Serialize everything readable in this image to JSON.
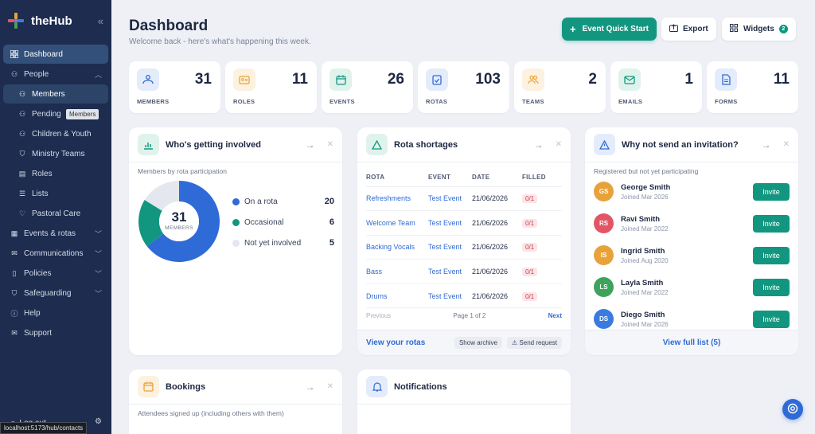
{
  "sidebar": {
    "brand": "theHub",
    "items": [
      {
        "label": "Dashboard"
      },
      {
        "label": "People"
      },
      {
        "label": "Members"
      },
      {
        "label": "Pending"
      },
      {
        "label": "Children & Youth"
      },
      {
        "label": "Ministry Teams"
      },
      {
        "label": "Roles"
      },
      {
        "label": "Lists"
      },
      {
        "label": "Pastoral Care"
      },
      {
        "label": "Events & rotas"
      },
      {
        "label": "Communications"
      },
      {
        "label": "Policies"
      },
      {
        "label": "Safeguarding"
      },
      {
        "label": "Help"
      },
      {
        "label": "Support"
      }
    ],
    "tooltip": "Members",
    "logout": "Log out"
  },
  "status_url": "localhost:5173/hub/contacts",
  "header": {
    "title": "Dashboard",
    "subtitle": "Welcome back - here's what's happening this week.",
    "quick_start": "Event Quick Start",
    "export": "Export",
    "widgets": "Widgets",
    "widgets_count": "2"
  },
  "stats": [
    {
      "label": "MEMBERS",
      "value": "31",
      "icon": "members-icon"
    },
    {
      "label": "ROLES",
      "value": "11",
      "icon": "id-badge-icon"
    },
    {
      "label": "EVENTS",
      "value": "26",
      "icon": "calendar-icon"
    },
    {
      "label": "ROTAS",
      "value": "103",
      "icon": "clipboard-check-icon"
    },
    {
      "label": "TEAMS",
      "value": "2",
      "icon": "team-icon"
    },
    {
      "label": "EMAILS",
      "value": "1",
      "icon": "envelope-icon"
    },
    {
      "label": "FORMS",
      "value": "11",
      "icon": "document-icon"
    }
  ],
  "involved": {
    "title": "Who's getting involved",
    "subtitle": "Members by rota participation",
    "total": "31",
    "total_label": "MEMBERS",
    "legend": [
      {
        "label": "On a rota",
        "value": "20",
        "color": "#2f6bd6"
      },
      {
        "label": "Occasional",
        "value": "6",
        "color": "#13967f"
      },
      {
        "label": "Not yet involved",
        "value": "5",
        "color": "#e4e7ee"
      }
    ]
  },
  "rota": {
    "title": "Rota shortages",
    "columns": [
      "ROTA",
      "EVENT",
      "DATE",
      "FILLED"
    ],
    "rows": [
      [
        "Refreshments",
        "Test Event",
        "21/06/2026",
        "0/1"
      ],
      [
        "Welcome Team",
        "Test Event",
        "21/06/2026",
        "0/1"
      ],
      [
        "Backing Vocals",
        "Test Event",
        "21/06/2026",
        "0/1"
      ],
      [
        "Bass",
        "Test Event",
        "21/06/2026",
        "0/1"
      ],
      [
        "Drums",
        "Test Event",
        "21/06/2026",
        "0/1"
      ]
    ],
    "previous": "Previous",
    "page": "Page 1 of 2",
    "next": "Next",
    "view": "View your rotas",
    "archive": "Show archive",
    "send": "Send request"
  },
  "invite": {
    "title": "Why not send an invitation?",
    "subtitle": "Registered but not yet participating",
    "people": [
      {
        "initials": "GS",
        "name": "George Smith",
        "joined": "Joined Mar 2026",
        "color": "#e8a23a"
      },
      {
        "initials": "RS",
        "name": "Ravi Smith",
        "joined": "Joined Mar 2022",
        "color": "#e25565"
      },
      {
        "initials": "IS",
        "name": "Ingrid Smith",
        "joined": "Joined Aug 2020",
        "color": "#e8a23a"
      },
      {
        "initials": "LS",
        "name": "Layla Smith",
        "joined": "Joined Mar 2022",
        "color": "#3da35a"
      },
      {
        "initials": "DS",
        "name": "Diego Smith",
        "joined": "Joined Mar 2026",
        "color": "#3b7be0"
      }
    ],
    "button": "Invite",
    "view_all": "View full list (5)"
  },
  "bookings": {
    "title": "Bookings",
    "subtitle": "Attendees signed up (including others with them)"
  },
  "notifications": {
    "title": "Notifications"
  }
}
